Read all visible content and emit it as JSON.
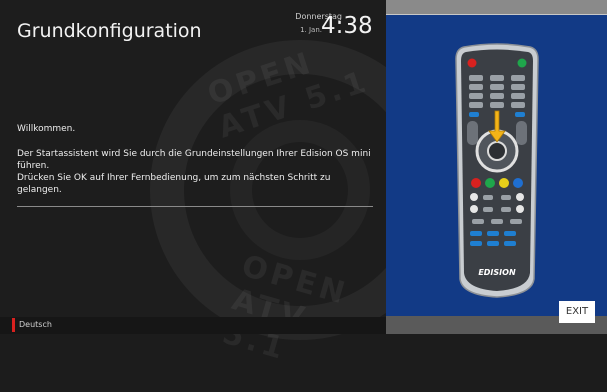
{
  "header": {
    "title": "Grundkonfiguration",
    "day": "Donnerstag",
    "date": "1. Jan.",
    "time": "4:38"
  },
  "content": {
    "welcome": "Willkommen.",
    "line1": "Der Startassistent wird Sie durch die Grundeinstellungen Ihrer Edision OS mini führen.",
    "line2": "Drücken Sie OK auf Ihrer Fernbedienung, um zum nächsten Schritt zu gelangen."
  },
  "watermark": {
    "text_top": "OPEN ATV 5.1",
    "text_bottom": "OPEN ATV 5.1"
  },
  "footer": {
    "language": "Deutsch"
  },
  "remote": {
    "brand": "EDISION",
    "exit_label": "EXIT"
  },
  "colors": {
    "accent": "#d8211f",
    "panel_blue": "#123a86",
    "remote_body": "#c9cdd1",
    "arrow": "#f4b418"
  }
}
